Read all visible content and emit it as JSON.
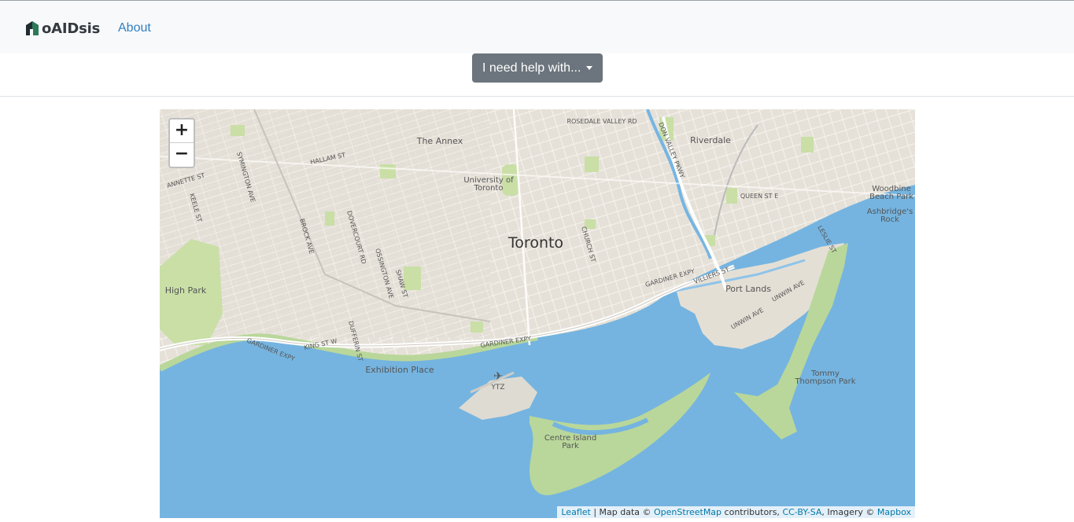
{
  "navbar": {
    "brand": "oAIDsis",
    "links": [
      "About"
    ]
  },
  "help_dropdown": {
    "label": "I need help with..."
  },
  "map": {
    "zoom_in": "+",
    "zoom_out": "−",
    "labels": {
      "city": "Toronto",
      "annex": "The Annex",
      "riverdale": "Riverdale",
      "uoft_1": "University of",
      "uoft_2": "Toronto",
      "rosedale": "ROSEDALE VALLEY RD",
      "donvalley": "DON VALLEY PKWY",
      "queen": "QUEEN ST E",
      "woodbine_1": "Woodbine",
      "woodbine_2": "Beach Park",
      "ashbridge_1": "Ashbridge's",
      "ashbridge_2": "Rock",
      "hallam": "HALLAM ST",
      "annette": "ANNETTE ST",
      "symington": "SYMINGTON AVE",
      "keele": "KEELE ST",
      "brock": "BROCK AVE",
      "dovercourt": "DOVERCOURT RD",
      "ossington": "OSSINGTON AVE",
      "shaw": "SHAW ST",
      "church": "CHURCH ST",
      "leslie": "LESLIE ST",
      "villiers": "VILLIERS ST",
      "gardiner": "GARDINER EXPY",
      "portlands": "Port Lands",
      "unwin": "UNWIN AVE",
      "highpark": "High Park",
      "kingst": "KING ST W",
      "dufferin": "DUFFERIN ST",
      "exhibition": "Exhibition Place",
      "ytz": "YTZ",
      "tommy_1": "Tommy",
      "tommy_2": "Thompson Park",
      "centre_1": "Centre Island",
      "centre_2": "Park"
    },
    "attribution": {
      "leaflet": "Leaflet",
      "sep": " | Map data © ",
      "osm": "OpenStreetMap",
      "contrib": " contributors, ",
      "license": "CC-BY-SA",
      "imagery": ", Imagery © ",
      "mapbox": "Mapbox"
    }
  }
}
